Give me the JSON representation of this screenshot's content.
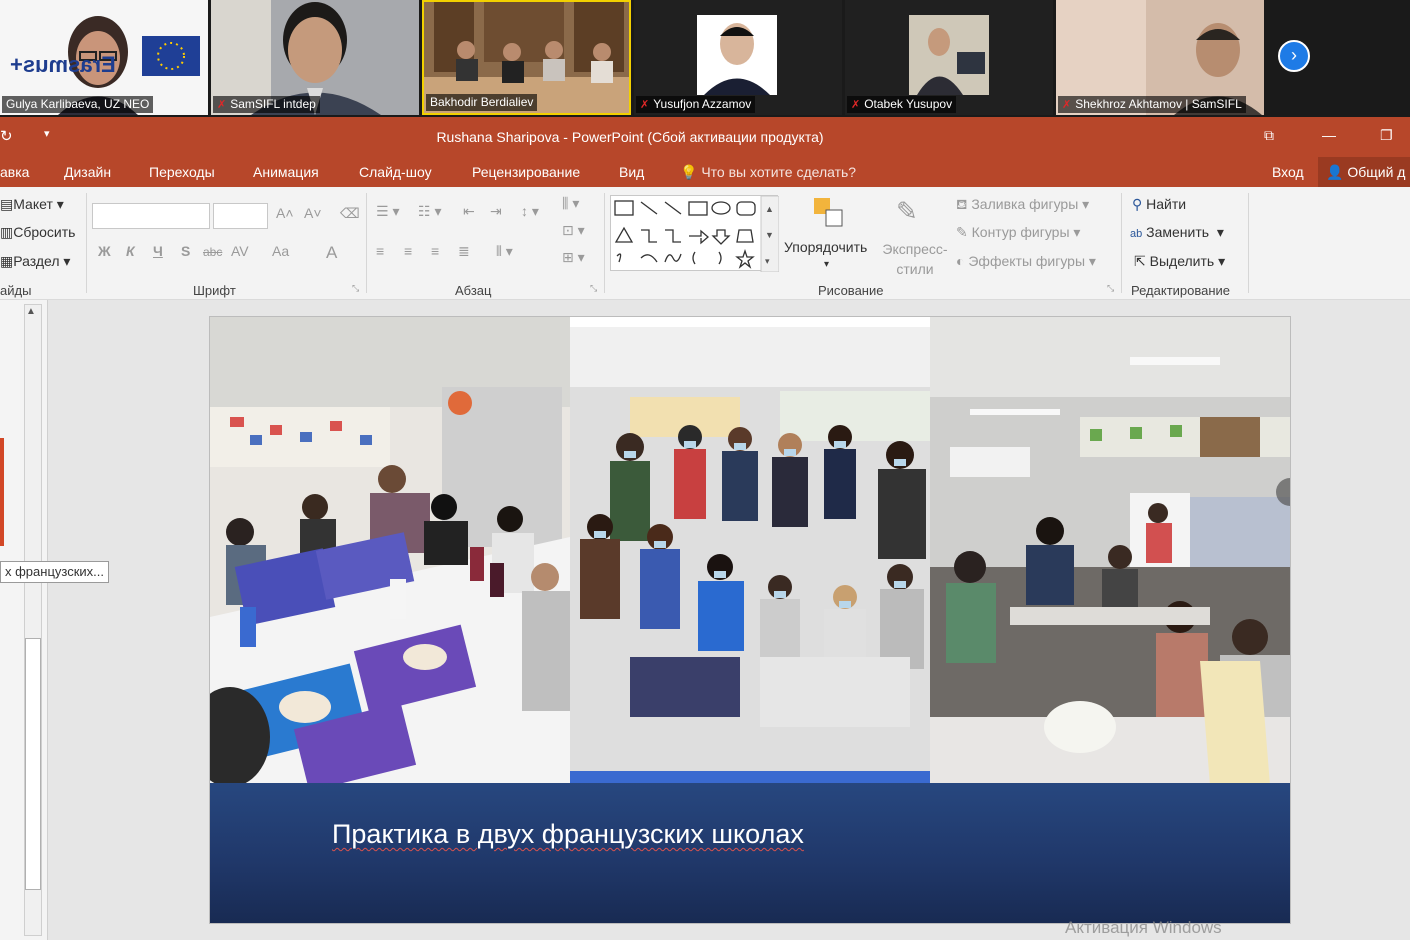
{
  "zoom": {
    "participants": [
      {
        "name": "Gulya Karlibaeva, UZ NEO",
        "muted": false
      },
      {
        "name": "SamSIFL intdep",
        "muted": true
      },
      {
        "name": "Bakhodir Berdialiev",
        "muted": false
      },
      {
        "name": "Yusufjon Azzamov",
        "muted": true
      },
      {
        "name": "Otabek Yusupov",
        "muted": true
      },
      {
        "name": "Shekhroz Akhtamov | SamSIFL",
        "muted": true
      }
    ],
    "erasmus_logo_text": "Erasmus+",
    "next_icon": "chevron-right-icon"
  },
  "powerpoint": {
    "title": "Rushana Sharipova - PowerPoint (Сбой активации продукта)",
    "tabs": [
      "авка",
      "Дизайн",
      "Переходы",
      "Анимация",
      "Слайд-шоу",
      "Рецензирование",
      "Вид"
    ],
    "tell_me": "Что вы хотите сделать?",
    "signin": "Вход",
    "share": "Общий д",
    "ribbon": {
      "slides_group": {
        "items": [
          "Макет",
          "Сбросить",
          "Раздел"
        ],
        "label": "айды"
      },
      "font_group": {
        "label": "Шрифт",
        "buttons": [
          "Ж",
          "К",
          "Ч",
          "S",
          "abc",
          "AV",
          "Aa",
          "A"
        ]
      },
      "paragraph_group": {
        "label": "Абзац"
      },
      "drawing_group": {
        "label": "Рисование",
        "arrange": "Упорядочить",
        "quick_styles": "Экспресс-стили",
        "fill": "Заливка фигуры",
        "outline": "Контур фигуры",
        "effects": "Эффекты фигуры"
      },
      "editing_group": {
        "label": "Редактирование",
        "find": "Найти",
        "replace": "Заменить",
        "select": "Выделить"
      }
    }
  },
  "workspace": {
    "thumbnail_tooltip": "х французских...",
    "slide_caption": "Практика в двух французских школах"
  },
  "watermark": "Активация Windows",
  "colors": {
    "accent": "#b7472a",
    "slide_banner": "#24437a"
  }
}
